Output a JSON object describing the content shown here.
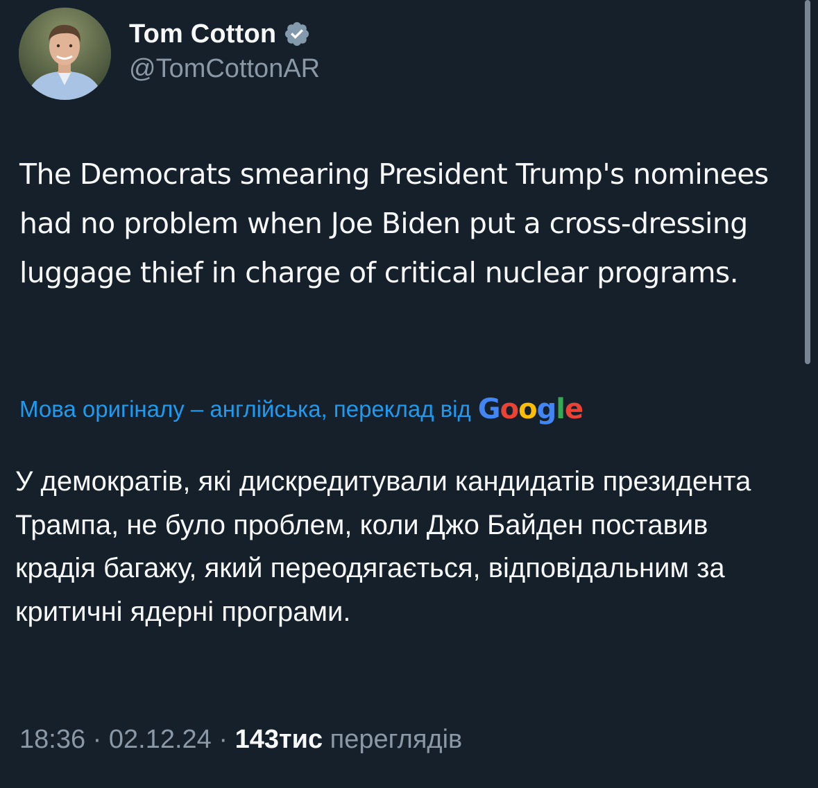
{
  "author": {
    "display_name": "Tom Cotton",
    "handle": "@TomCottonAR",
    "verified_badge_icon": "verified-badge-icon",
    "verified_badge_color": "#829aab"
  },
  "tweet": {
    "text": "The Democrats smearing President Trump's nominees had no problem when Joe Biden put a cross-dressing luggage thief in charge of critical nuclear programs.",
    "translation_note": "Мова оригіналу – англійська, переклад від",
    "translation_provider": [
      "G",
      "o",
      "o",
      "g",
      "l",
      "e"
    ],
    "translated_text": "У демократів, які дискредитували кандидатів президента Трампа, не було проблем, коли Джо Байден поставив крадія багажу, який переодягається, відповідальним за критичні ядерні програми."
  },
  "meta": {
    "time": "18:36",
    "separator": "·",
    "date": "02.12.24",
    "views_count": "143тис",
    "views_label": "переглядів"
  },
  "colors": {
    "background": "#15202b",
    "text_primary": "#f7f9f9",
    "text_secondary": "#8b98a5",
    "link": "#1d9bf0",
    "google_blue": "#4285f4",
    "google_red": "#ea4335",
    "google_yellow": "#fbbc05",
    "google_green": "#34a853"
  }
}
